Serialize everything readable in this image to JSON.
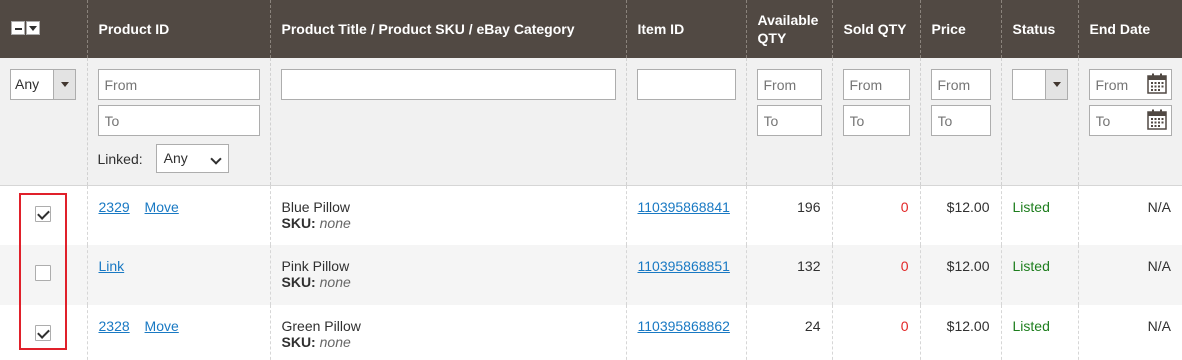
{
  "columns": {
    "product_id": "Product ID",
    "title": "Product Title / Product SKU / eBay Category",
    "item_id": "Item ID",
    "available_qty_1": "Available",
    "available_qty_2": "QTY",
    "sold_qty": "Sold QTY",
    "price": "Price",
    "status": "Status",
    "end_date": "End Date"
  },
  "filters": {
    "mass_select_value": "Any",
    "from_placeholder": "From",
    "to_placeholder": "To",
    "linked_label": "Linked:",
    "linked_value": "Any",
    "status_value": ""
  },
  "rows": [
    {
      "checked": true,
      "product_id": "2329",
      "action": "Move",
      "title": "Blue Pillow",
      "sku_label": "SKU:",
      "sku": "none",
      "item_id": "110395868841",
      "available_qty": "196",
      "sold_qty": "0",
      "price": "$12.00",
      "status": "Listed",
      "end_date": "N/A"
    },
    {
      "checked": false,
      "product_id": "",
      "action": "Link",
      "title": "Pink Pillow",
      "sku_label": "SKU:",
      "sku": "none",
      "item_id": "110395868851",
      "available_qty": "132",
      "sold_qty": "0",
      "price": "$12.00",
      "status": "Listed",
      "end_date": "N/A"
    },
    {
      "checked": true,
      "product_id": "2328",
      "action": "Move",
      "title": "Green Pillow",
      "sku_label": "SKU:",
      "sku": "none",
      "item_id": "110395868862",
      "available_qty": "24",
      "sold_qty": "0",
      "price": "$12.00",
      "status": "Listed",
      "end_date": "N/A"
    }
  ],
  "colors": {
    "header_bg": "#514943",
    "link": "#1979c3",
    "status_listed": "#1e7e1e",
    "sold_zero": "#e22626",
    "highlight_box": "#e0202a"
  }
}
